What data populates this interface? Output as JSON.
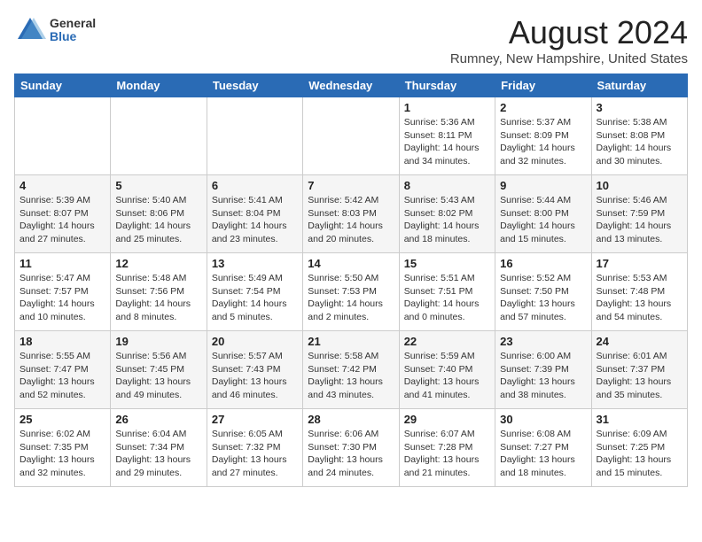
{
  "header": {
    "logo_general": "General",
    "logo_blue": "Blue",
    "month_title": "August 2024",
    "location": "Rumney, New Hampshire, United States"
  },
  "weekdays": [
    "Sunday",
    "Monday",
    "Tuesday",
    "Wednesday",
    "Thursday",
    "Friday",
    "Saturday"
  ],
  "weeks": [
    [
      {
        "day": "",
        "info": ""
      },
      {
        "day": "",
        "info": ""
      },
      {
        "day": "",
        "info": ""
      },
      {
        "day": "",
        "info": ""
      },
      {
        "day": "1",
        "info": "Sunrise: 5:36 AM\nSunset: 8:11 PM\nDaylight: 14 hours\nand 34 minutes."
      },
      {
        "day": "2",
        "info": "Sunrise: 5:37 AM\nSunset: 8:09 PM\nDaylight: 14 hours\nand 32 minutes."
      },
      {
        "day": "3",
        "info": "Sunrise: 5:38 AM\nSunset: 8:08 PM\nDaylight: 14 hours\nand 30 minutes."
      }
    ],
    [
      {
        "day": "4",
        "info": "Sunrise: 5:39 AM\nSunset: 8:07 PM\nDaylight: 14 hours\nand 27 minutes."
      },
      {
        "day": "5",
        "info": "Sunrise: 5:40 AM\nSunset: 8:06 PM\nDaylight: 14 hours\nand 25 minutes."
      },
      {
        "day": "6",
        "info": "Sunrise: 5:41 AM\nSunset: 8:04 PM\nDaylight: 14 hours\nand 23 minutes."
      },
      {
        "day": "7",
        "info": "Sunrise: 5:42 AM\nSunset: 8:03 PM\nDaylight: 14 hours\nand 20 minutes."
      },
      {
        "day": "8",
        "info": "Sunrise: 5:43 AM\nSunset: 8:02 PM\nDaylight: 14 hours\nand 18 minutes."
      },
      {
        "day": "9",
        "info": "Sunrise: 5:44 AM\nSunset: 8:00 PM\nDaylight: 14 hours\nand 15 minutes."
      },
      {
        "day": "10",
        "info": "Sunrise: 5:46 AM\nSunset: 7:59 PM\nDaylight: 14 hours\nand 13 minutes."
      }
    ],
    [
      {
        "day": "11",
        "info": "Sunrise: 5:47 AM\nSunset: 7:57 PM\nDaylight: 14 hours\nand 10 minutes."
      },
      {
        "day": "12",
        "info": "Sunrise: 5:48 AM\nSunset: 7:56 PM\nDaylight: 14 hours\nand 8 minutes."
      },
      {
        "day": "13",
        "info": "Sunrise: 5:49 AM\nSunset: 7:54 PM\nDaylight: 14 hours\nand 5 minutes."
      },
      {
        "day": "14",
        "info": "Sunrise: 5:50 AM\nSunset: 7:53 PM\nDaylight: 14 hours\nand 2 minutes."
      },
      {
        "day": "15",
        "info": "Sunrise: 5:51 AM\nSunset: 7:51 PM\nDaylight: 14 hours\nand 0 minutes."
      },
      {
        "day": "16",
        "info": "Sunrise: 5:52 AM\nSunset: 7:50 PM\nDaylight: 13 hours\nand 57 minutes."
      },
      {
        "day": "17",
        "info": "Sunrise: 5:53 AM\nSunset: 7:48 PM\nDaylight: 13 hours\nand 54 minutes."
      }
    ],
    [
      {
        "day": "18",
        "info": "Sunrise: 5:55 AM\nSunset: 7:47 PM\nDaylight: 13 hours\nand 52 minutes."
      },
      {
        "day": "19",
        "info": "Sunrise: 5:56 AM\nSunset: 7:45 PM\nDaylight: 13 hours\nand 49 minutes."
      },
      {
        "day": "20",
        "info": "Sunrise: 5:57 AM\nSunset: 7:43 PM\nDaylight: 13 hours\nand 46 minutes."
      },
      {
        "day": "21",
        "info": "Sunrise: 5:58 AM\nSunset: 7:42 PM\nDaylight: 13 hours\nand 43 minutes."
      },
      {
        "day": "22",
        "info": "Sunrise: 5:59 AM\nSunset: 7:40 PM\nDaylight: 13 hours\nand 41 minutes."
      },
      {
        "day": "23",
        "info": "Sunrise: 6:00 AM\nSunset: 7:39 PM\nDaylight: 13 hours\nand 38 minutes."
      },
      {
        "day": "24",
        "info": "Sunrise: 6:01 AM\nSunset: 7:37 PM\nDaylight: 13 hours\nand 35 minutes."
      }
    ],
    [
      {
        "day": "25",
        "info": "Sunrise: 6:02 AM\nSunset: 7:35 PM\nDaylight: 13 hours\nand 32 minutes."
      },
      {
        "day": "26",
        "info": "Sunrise: 6:04 AM\nSunset: 7:34 PM\nDaylight: 13 hours\nand 29 minutes."
      },
      {
        "day": "27",
        "info": "Sunrise: 6:05 AM\nSunset: 7:32 PM\nDaylight: 13 hours\nand 27 minutes."
      },
      {
        "day": "28",
        "info": "Sunrise: 6:06 AM\nSunset: 7:30 PM\nDaylight: 13 hours\nand 24 minutes."
      },
      {
        "day": "29",
        "info": "Sunrise: 6:07 AM\nSunset: 7:28 PM\nDaylight: 13 hours\nand 21 minutes."
      },
      {
        "day": "30",
        "info": "Sunrise: 6:08 AM\nSunset: 7:27 PM\nDaylight: 13 hours\nand 18 minutes."
      },
      {
        "day": "31",
        "info": "Sunrise: 6:09 AM\nSunset: 7:25 PM\nDaylight: 13 hours\nand 15 minutes."
      }
    ]
  ]
}
